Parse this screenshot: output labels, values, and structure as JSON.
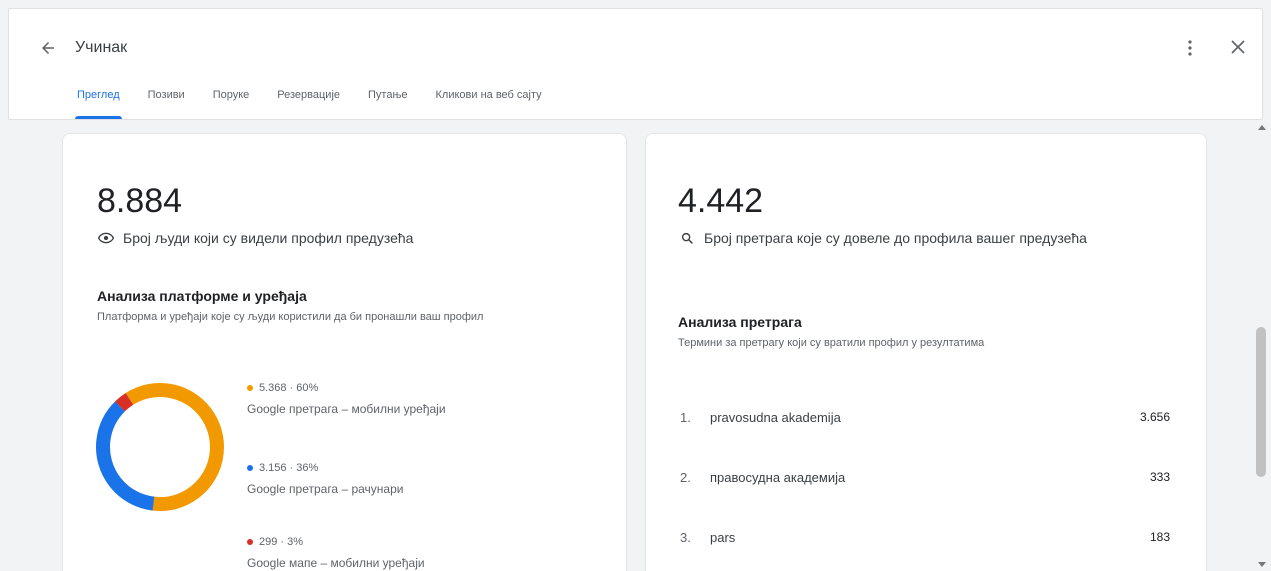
{
  "header": {
    "title": "Учинак",
    "tabs": [
      {
        "label": "Преглед",
        "active": true
      },
      {
        "label": "Позиви"
      },
      {
        "label": "Поруке"
      },
      {
        "label": "Резервације"
      },
      {
        "label": "Путање"
      },
      {
        "label": "Кликови на веб сајту"
      }
    ],
    "icons": {
      "back": "arrow-left-icon",
      "more": "more-vert-icon",
      "close": "close-icon"
    }
  },
  "left_card": {
    "value": "8.884",
    "metric_label": "Број људи који су видели профил предузећа",
    "metric_icon": "eye-icon",
    "analysis_title": "Анализа платформе и уређаја",
    "analysis_subtitle": "Платформа и уређаји које су људи користили да би пронашли ваш профил",
    "chart_data": {
      "type": "pie",
      "categories": [
        "Google претрага – мобилни уређаји",
        "Google претрага – рачунари",
        "Google мапе – мобилни уређаји"
      ],
      "values": [
        5368,
        3156,
        299
      ],
      "percentages": [
        60,
        36,
        3
      ],
      "colors": [
        "#f29900",
        "#1a73e8",
        "#d93025"
      ]
    },
    "legend": [
      {
        "value": "5.368 · 60%",
        "label": "Google претрага – мобилни уређаји",
        "color": "#f29900"
      },
      {
        "value": "3.156 · 36%",
        "label": "Google претрага – рачунари",
        "color": "#1a73e8"
      },
      {
        "value": "299 · 3%",
        "label": "Google мапе – мобилни уређаји",
        "color": "#d93025"
      }
    ]
  },
  "right_card": {
    "value": "4.442",
    "metric_label": "Број претрага које су довеле до профила вашег предузећа",
    "metric_icon": "search-icon",
    "analysis_title": "Анализа претрага",
    "analysis_subtitle": "Термини за претрагу који су вратили профил у резултатима",
    "terms": [
      {
        "rank": "1.",
        "term": "pravosudna akademija",
        "count": "3.656"
      },
      {
        "rank": "2.",
        "term": "правосудна академија",
        "count": "333"
      },
      {
        "rank": "3.",
        "term": "pars",
        "count": "183"
      }
    ]
  }
}
